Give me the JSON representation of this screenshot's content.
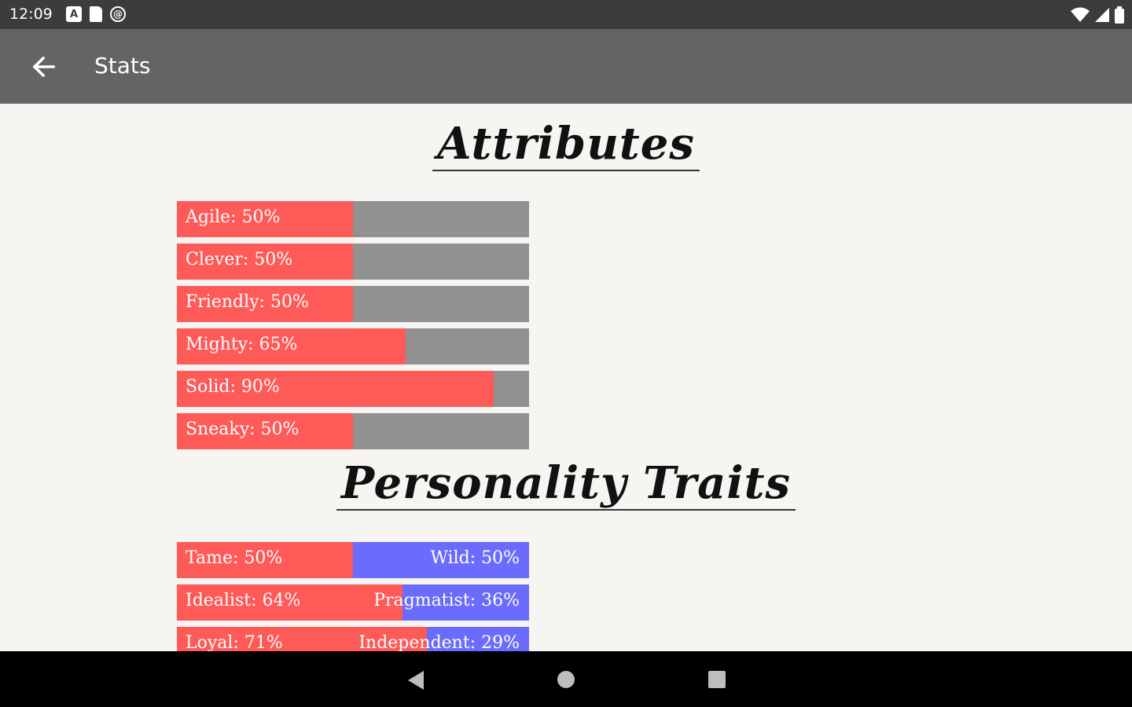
{
  "status_bar": {
    "time": "12:09",
    "left_icons": [
      "a-notification-icon",
      "sd-card-icon",
      "sync-icon"
    ],
    "right_icons": [
      "wifi-icon",
      "cell-signal-icon",
      "battery-icon"
    ]
  },
  "app_bar": {
    "title": "Stats",
    "back_icon": "arrow-back-icon"
  },
  "attributes": {
    "title": "Attributes",
    "items": [
      {
        "label": "Agile: 50%",
        "value": 50
      },
      {
        "label": "Clever: 50%",
        "value": 50
      },
      {
        "label": "Friendly: 50%",
        "value": 50
      },
      {
        "label": "Mighty: 65%",
        "value": 65
      },
      {
        "label": "Solid: 90%",
        "value": 90
      },
      {
        "label": "Sneaky: 50%",
        "value": 50
      }
    ]
  },
  "traits": {
    "title": "Personality Traits",
    "items": [
      {
        "left_label": "Tame: 50%",
        "right_label": "Wild: 50%",
        "value": 50
      },
      {
        "left_label": "Idealist: 64%",
        "right_label": "Pragmatist: 36%",
        "value": 64
      },
      {
        "left_label": "Loyal: 71%",
        "right_label": "Independent: 29%",
        "value": 71
      }
    ]
  },
  "colors": {
    "status_bar": "#3c3c3c",
    "app_bar": "#646464",
    "background": "#f7f5f1",
    "fill_red": "#fd5a58",
    "empty_gray": "#919191",
    "trait_blue": "#6b6bfd",
    "nav_bar": "#000000"
  },
  "nav_bar": {
    "icons": [
      "nav-back-icon",
      "nav-home-icon",
      "nav-recents-icon"
    ]
  }
}
